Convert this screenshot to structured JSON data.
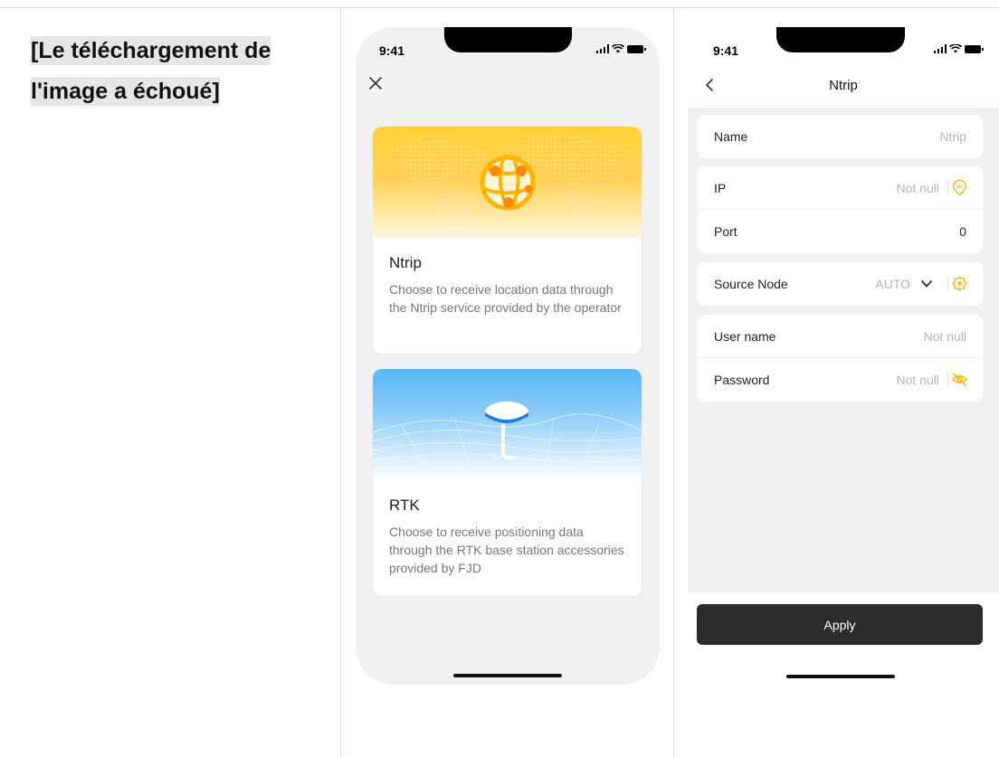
{
  "failed_image_text": "[Le téléchargement de l'image a échoué]",
  "status": {
    "time": "9:41"
  },
  "mode_select": {
    "cards": [
      {
        "title": "Ntrip",
        "description": "Choose to receive location data through the Ntrip service provided by the operator",
        "icon": "globe-network-icon"
      },
      {
        "title": "RTK",
        "description": "Choose to receive positioning data through the RTK base station accessories provided by FJD",
        "icon": "rtk-antenna-icon"
      }
    ]
  },
  "ntrip_form": {
    "title": "Ntrip",
    "fields": {
      "name": {
        "label": "Name",
        "value": "Ntrip"
      },
      "ip": {
        "label": "IP",
        "value": "Not null",
        "icon": "ip-location-icon"
      },
      "port": {
        "label": "Port",
        "value": "0"
      },
      "source_node": {
        "label": "Source Node",
        "value": "AUTO",
        "icon": "refresh-node-icon"
      },
      "username": {
        "label": "User name",
        "value": "Not null"
      },
      "password": {
        "label": "Password",
        "value": "Not null",
        "icon": "eye-off-icon"
      }
    },
    "apply_label": "Apply"
  },
  "colors": {
    "accent": "#f5b800",
    "button": "#2d2d2d",
    "background": "#f1f1f1"
  }
}
